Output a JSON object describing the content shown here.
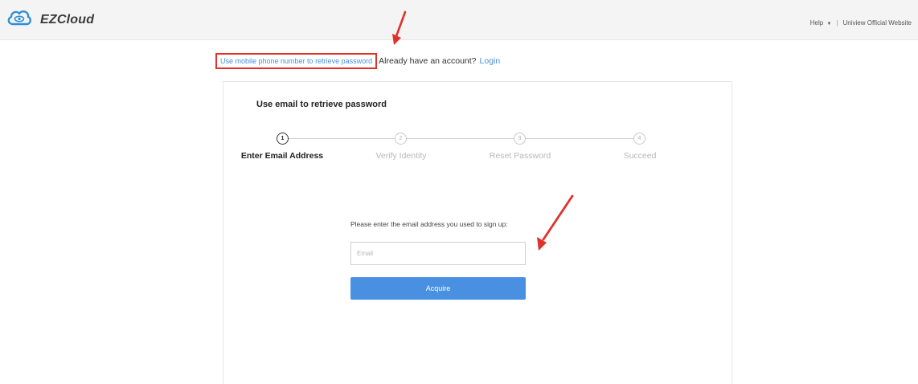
{
  "header": {
    "logo_text": "EZCloud",
    "help_label": "Help",
    "separator": "|",
    "official_site_label": "Uniview Official Website"
  },
  "links": {
    "mobile_retrieve": "Use mobile phone number to retrieve password",
    "have_account": "Already have an account?",
    "login": "Login"
  },
  "card": {
    "title": "Use email to retrieve password",
    "steps": [
      {
        "number": "1",
        "label": "Enter Email Address",
        "active": true
      },
      {
        "number": "2",
        "label": "Verify Identity",
        "active": false
      },
      {
        "number": "3",
        "label": "Reset Password",
        "active": false
      },
      {
        "number": "4",
        "label": "Succeed",
        "active": false
      }
    ],
    "prompt": "Please enter the email address you used to sign up:",
    "email": {
      "value": "",
      "placeholder": "Email"
    },
    "acquire_label": "Acquire"
  },
  "colors": {
    "accent": "#4a90e2",
    "link": "#4a90d9",
    "annotation_red": "#e0322b",
    "header_bg": "#f4f4f4"
  },
  "icons": {
    "logo": "cloud-eye-icon",
    "help_caret": "caret-down-icon"
  }
}
